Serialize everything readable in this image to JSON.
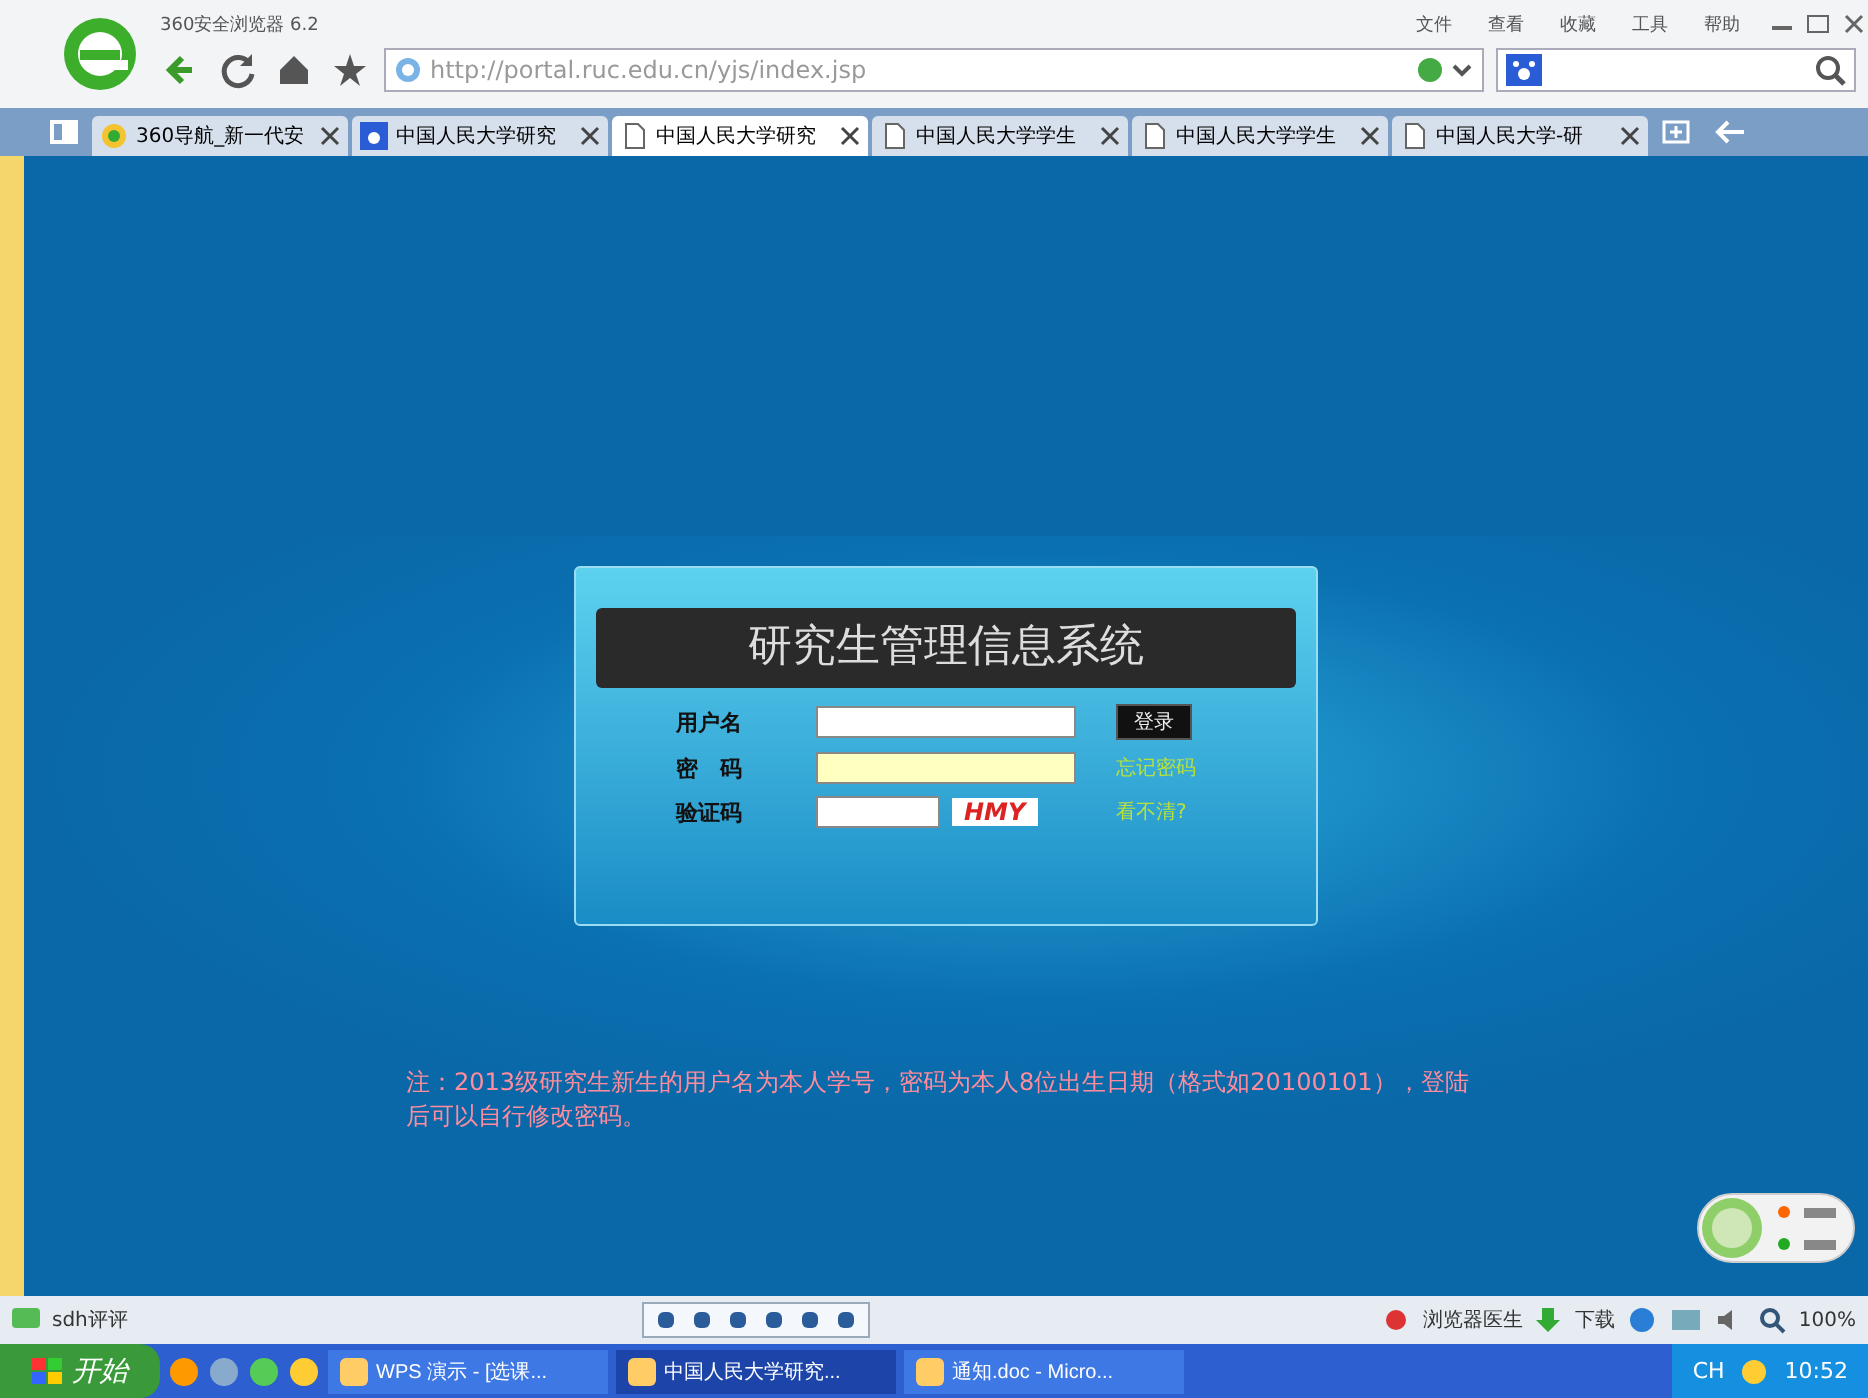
{
  "window": {
    "title": "360安全浏览器 6.2",
    "menu": [
      "文件",
      "查看",
      "收藏",
      "工具",
      "帮助"
    ]
  },
  "address_bar": {
    "url": "http://portal.ruc.edu.cn/yjs/index.jsp"
  },
  "tabs": [
    {
      "label": "360导航_新一代安",
      "selected": false,
      "kind": "nav"
    },
    {
      "label": "中国人民大学研究",
      "selected": false,
      "kind": "paw"
    },
    {
      "label": "中国人民大学研究",
      "selected": true,
      "kind": "page"
    },
    {
      "label": "中国人民大学学生",
      "selected": false,
      "kind": "page"
    },
    {
      "label": "中国人民大学学生",
      "selected": false,
      "kind": "page"
    },
    {
      "label": "中国人民大学-研",
      "selected": false,
      "kind": "page"
    }
  ],
  "login": {
    "title": "研究生管理信息系统",
    "username_label": "用户名",
    "password_label": "密　码",
    "captcha_label": "验证码",
    "login_button": "登录",
    "forgot_link": "忘记密码",
    "captcha_text": "HMY",
    "refresh_link": "看不清?"
  },
  "notice": "注：2013级研究生新生的用户名为本人学号，密码为本人8位出生日期（格式如20100101），登陆后可以自行修改密码。",
  "status_bar": {
    "left": "sdh评评",
    "doctor": "浏览器医生",
    "download": "下载",
    "zoom": "100%"
  },
  "taskbar": {
    "start": "开始",
    "tasks": [
      {
        "label": "WPS 演示 - [选课...",
        "selected": false
      },
      {
        "label": "中国人民大学研究...",
        "selected": true
      },
      {
        "label": "通知.doc - Micro...",
        "selected": false
      }
    ],
    "lang": "CH",
    "clock": "10:52"
  }
}
